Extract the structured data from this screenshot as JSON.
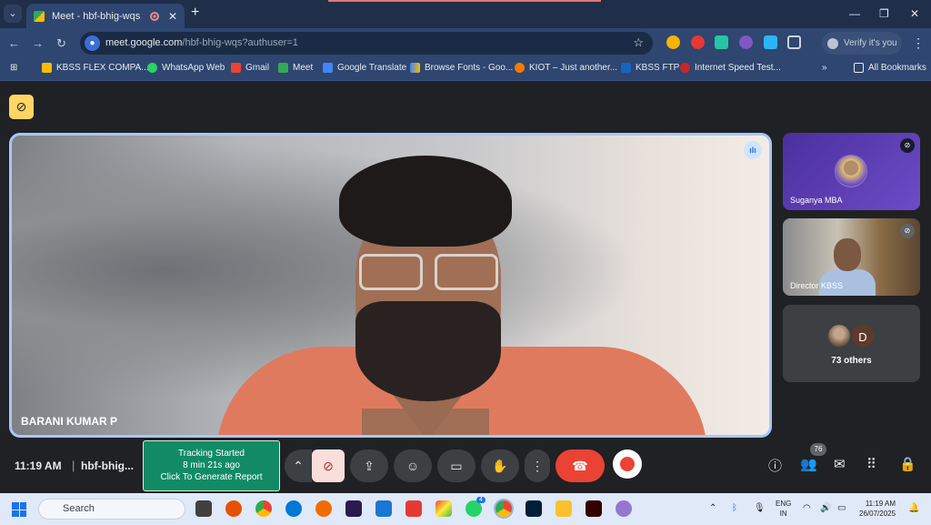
{
  "browser": {
    "tab_title": "Meet - hbf-bhig-wqs",
    "url_host": "meet.google.com",
    "url_path": "/hbf-bhig-wqs?authuser=1",
    "profile_label": "Verify it's you",
    "bookmarks": [
      "KBSS FLEX COMPA...",
      "WhatsApp Web",
      "Gmail",
      "Meet",
      "Google Translate",
      "Browse Fonts - Goo...",
      "KIOT – Just another...",
      "KBSS FTP",
      "Internet Speed Test..."
    ],
    "all_bookmarks": "All Bookmarks",
    "more_bookmarks": "»"
  },
  "meet": {
    "main_participant": "BARANI KUMAR P",
    "side_participants": [
      "Suganya MBA",
      "Director KBSS"
    ],
    "others_avatar_letter": "D",
    "others_label": "73 others",
    "time": "11:19 AM",
    "separator": "|",
    "meeting_code": "hbf-bhig...",
    "tracking": {
      "line1": "Tracking Started",
      "line2": "8 min 21s ago",
      "line3": "Click To Generate Report"
    },
    "participant_count": "76",
    "colors": {
      "accent": "#a8c7fa",
      "end_call": "#ea4335",
      "tracking_bg": "#128b64"
    }
  },
  "taskbar": {
    "search_placeholder": "Search",
    "lang_line1": "ENG",
    "lang_line2": "IN",
    "clock_time": "11:19 AM",
    "clock_date": "26/07/2025",
    "whatsapp_badge": "4"
  }
}
